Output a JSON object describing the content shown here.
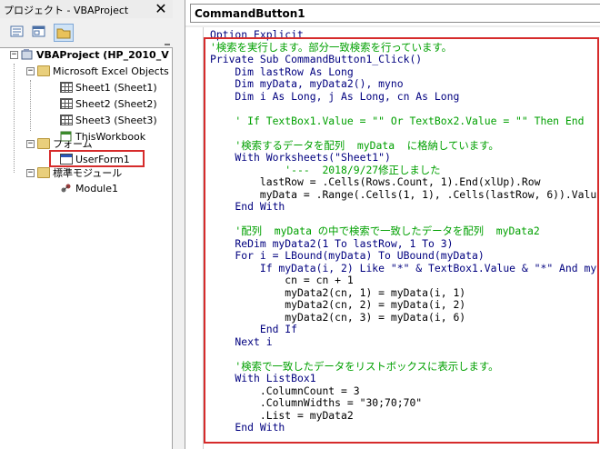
{
  "project_explorer": {
    "title": "プロジェクト - VBAProject",
    "close_glyph": "✕",
    "tree": {
      "project": "VBAProject (HP_2010_V",
      "folders": [
        {
          "label": "Microsoft Excel Objects",
          "items": [
            "Sheet1 (Sheet1)",
            "Sheet2 (Sheet2)",
            "Sheet3 (Sheet3)",
            "ThisWorkbook"
          ]
        },
        {
          "label": "フォーム",
          "items": [
            "UserForm1"
          ]
        },
        {
          "label": "標準モジュール",
          "items": [
            "Module1"
          ]
        }
      ]
    }
  },
  "code_window": {
    "object_combo": "CommandButton1",
    "lines": [
      {
        "t": "Option Explicit",
        "k": "kw"
      },
      {
        "t": "'検索を実行します。部分一致検索を行っています。",
        "k": "cm"
      },
      {
        "t": "Private Sub CommandButton1_Click()",
        "k": "kw"
      },
      {
        "t": "    Dim lastRow As Long",
        "k": "kw"
      },
      {
        "t": "    Dim myData, myData2(), myno",
        "k": "kw"
      },
      {
        "t": "    Dim i As Long, j As Long, cn As Long",
        "k": "kw"
      },
      {
        "t": "",
        "k": ""
      },
      {
        "t": "    ' If TextBox1.Value = \"\" Or TextBox2.Value = \"\" Then End",
        "k": "cm"
      },
      {
        "t": "",
        "k": ""
      },
      {
        "t": "    '検索するデータを配列  myData  に格納しています。",
        "k": "cm"
      },
      {
        "t": "    With Worksheets(\"Sheet1\")",
        "k": "kw"
      },
      {
        "t": "            '---  2018/9/27修正しました",
        "k": "cm"
      },
      {
        "t": "        lastRow = .Cells(Rows.Count, 1).End(xlUp).Row",
        "k": ""
      },
      {
        "t": "        myData = .Range(.Cells(1, 1), .Cells(lastRow, 6)).Valu",
        "k": ""
      },
      {
        "t": "    End With",
        "k": "kw"
      },
      {
        "t": "",
        "k": ""
      },
      {
        "t": "    '配列  myData の中で検索で一致したデータを配列  myData2  ",
        "k": "cm"
      },
      {
        "t": "    ReDim myData2(1 To lastRow, 1 To 3)",
        "k": "kw"
      },
      {
        "t": "    For i = LBound(myData) To UBound(myData)",
        "k": "kw"
      },
      {
        "t": "        If myData(i, 2) Like \"*\" & TextBox1.Value & \"*\" And my",
        "k": "kw"
      },
      {
        "t": "            cn = cn + 1",
        "k": ""
      },
      {
        "t": "            myData2(cn, 1) = myData(i, 1)",
        "k": ""
      },
      {
        "t": "            myData2(cn, 2) = myData(i, 2)",
        "k": ""
      },
      {
        "t": "            myData2(cn, 3) = myData(i, 6)",
        "k": ""
      },
      {
        "t": "        End If",
        "k": "kw"
      },
      {
        "t": "    Next i",
        "k": "kw"
      },
      {
        "t": "",
        "k": ""
      },
      {
        "t": "    '検索で一致したデータをリストボックスに表示します。",
        "k": "cm"
      },
      {
        "t": "    With ListBox1",
        "k": "kw"
      },
      {
        "t": "        .ColumnCount = 3",
        "k": ""
      },
      {
        "t": "        .ColumnWidths = \"30;70;70\"",
        "k": ""
      },
      {
        "t": "        .List = myData2",
        "k": ""
      },
      {
        "t": "    End With",
        "k": "kw"
      },
      {
        "t": "",
        "k": ""
      },
      {
        "t": "End Sub",
        "k": "kw"
      }
    ]
  },
  "colors": {
    "keyword": "#00007f",
    "comment": "#00a000",
    "highlight_box": "#d62b2b"
  }
}
